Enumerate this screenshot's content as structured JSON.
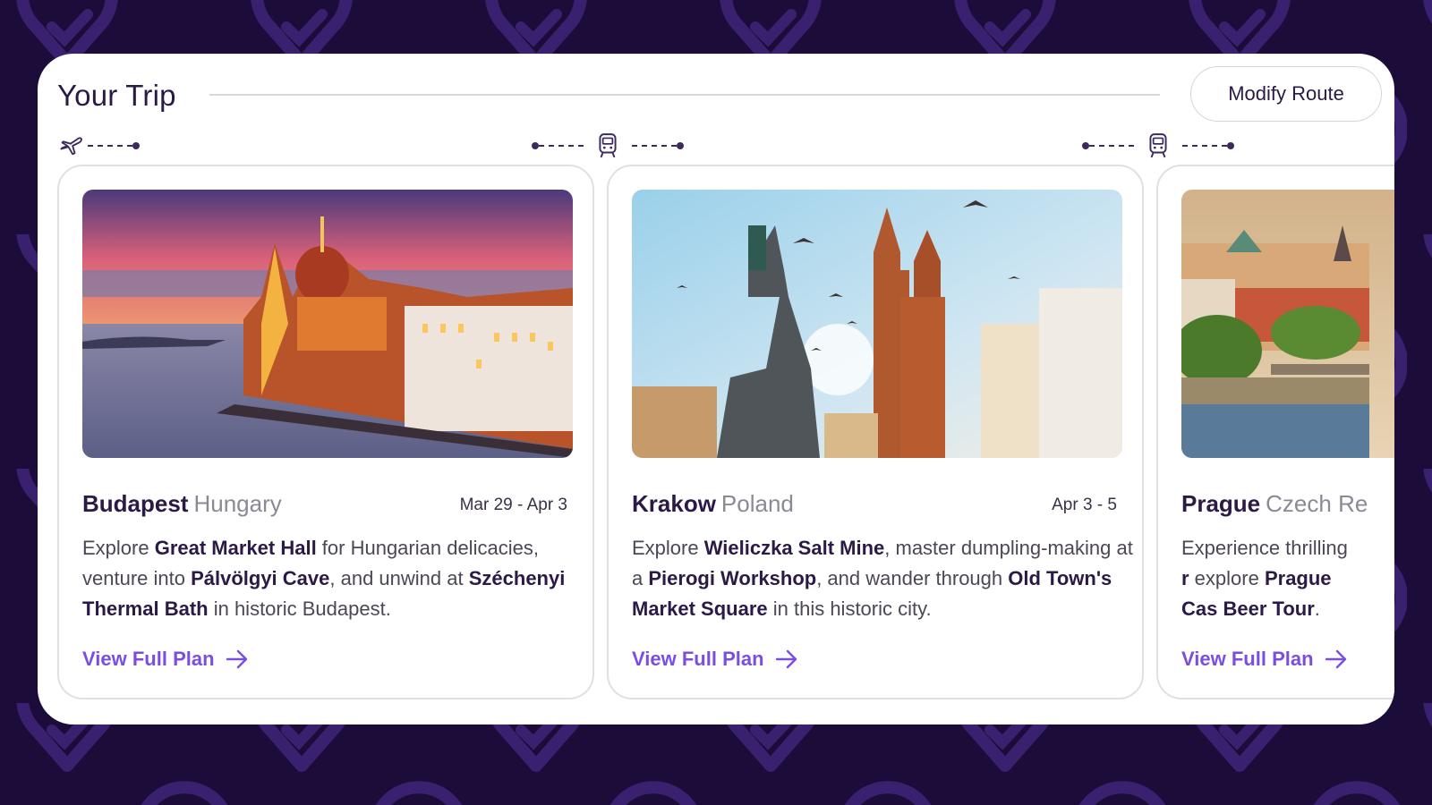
{
  "header": {
    "title": "Your Trip",
    "modify_button": "Modify Route"
  },
  "theme": {
    "accent": "#7b4ee0",
    "background": "#1b0c3a",
    "pattern": "#3a2170"
  },
  "route_icons": [
    "plane-icon",
    "train-icon",
    "train-icon"
  ],
  "cards": [
    {
      "city": "Budapest",
      "country": "Hungary",
      "dates": "Mar 29 - Apr 3",
      "d1": "Explore ",
      "b1": "Great Market Hall",
      "d2": " for Hungarian delicacies, venture into ",
      "b2": "Pálvölgyi Cave",
      "d3": ", and unwind at ",
      "b3": "Széchenyi Thermal Bath",
      "d4": " in historic Budapest.",
      "link": "View Full Plan"
    },
    {
      "city": "Krakow",
      "country": "Poland",
      "dates": "Apr 3 - 5",
      "d1": "Explore ",
      "b1": "Wieliczka Salt Mine",
      "d2": ", master dumpling-making at a ",
      "b2": "Pierogi Workshop",
      "d3": ", and wander through ",
      "b3": "Old Town's Market Square",
      "d4": " in this historic city.",
      "link": "View Full Plan"
    },
    {
      "city": "Prague",
      "country": "Czech Re",
      "dates": "",
      "d1": "Experience thrilling ",
      "b1": "r",
      "d2": " explore ",
      "b2": "Prague Cas",
      "d3": " ",
      "b3": "Beer Tour",
      "d4": ".",
      "link": "View Full Plan"
    }
  ]
}
